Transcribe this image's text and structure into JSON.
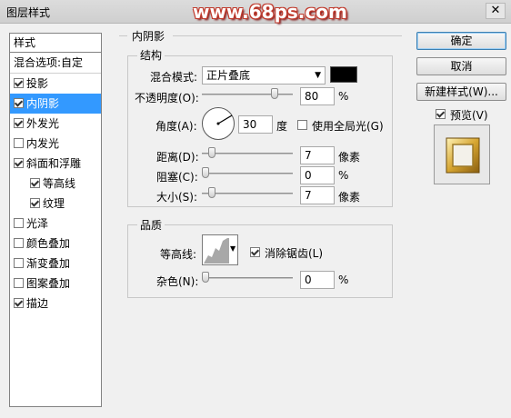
{
  "window": {
    "title": "图层样式",
    "watermark": "www.68ps.com",
    "close_glyph": "✕"
  },
  "sidebar": {
    "header": "样式",
    "items": [
      {
        "label": "混合选项:自定",
        "checkbox": false,
        "checked": false,
        "selected": false
      },
      {
        "label": "投影",
        "checkbox": true,
        "checked": true,
        "selected": false
      },
      {
        "label": "内阴影",
        "checkbox": true,
        "checked": true,
        "selected": true
      },
      {
        "label": "外发光",
        "checkbox": true,
        "checked": true,
        "selected": false
      },
      {
        "label": "内发光",
        "checkbox": true,
        "checked": false,
        "selected": false
      },
      {
        "label": "斜面和浮雕",
        "checkbox": true,
        "checked": true,
        "selected": false
      },
      {
        "label": "等高线",
        "checkbox": true,
        "checked": true,
        "selected": false,
        "sub": true
      },
      {
        "label": "纹理",
        "checkbox": true,
        "checked": true,
        "selected": false,
        "sub": true
      },
      {
        "label": "光泽",
        "checkbox": true,
        "checked": false,
        "selected": false
      },
      {
        "label": "颜色叠加",
        "checkbox": true,
        "checked": false,
        "selected": false
      },
      {
        "label": "渐变叠加",
        "checkbox": true,
        "checked": false,
        "selected": false
      },
      {
        "label": "图案叠加",
        "checkbox": true,
        "checked": false,
        "selected": false
      },
      {
        "label": "描边",
        "checkbox": true,
        "checked": true,
        "selected": false
      }
    ]
  },
  "inner_shadow": {
    "title": "内阴影",
    "structure": {
      "title": "结构",
      "blend_mode_label": "混合模式:",
      "blend_mode_value": "正片叠底",
      "shadow_color": "#000000",
      "opacity_label": "不透明度(O):",
      "opacity_value": "80",
      "opacity_unit": "%",
      "angle_label": "角度(A):",
      "angle_value": "30",
      "angle_unit": "度",
      "global_light_label": "使用全局光(G)",
      "global_light_checked": false,
      "distance_label": "距离(D):",
      "distance_value": "7",
      "distance_unit": "像素",
      "choke_label": "阻塞(C):",
      "choke_value": "0",
      "choke_unit": "%",
      "size_label": "大小(S):",
      "size_value": "7",
      "size_unit": "像素"
    },
    "quality": {
      "title": "品质",
      "contour_label": "等高线:",
      "antialias_label": "消除锯齿(L)",
      "antialias_checked": true,
      "noise_label": "杂色(N):",
      "noise_value": "0",
      "noise_unit": "%"
    }
  },
  "buttons": {
    "ok": "确定",
    "cancel": "取消",
    "new_style": "新建样式(W)...",
    "preview_label": "预览(V)",
    "preview_checked": true
  },
  "colors": {
    "selection": "#3399ff",
    "window_bg": "#f0f0f0",
    "watermark_outline": "#c0392b"
  }
}
